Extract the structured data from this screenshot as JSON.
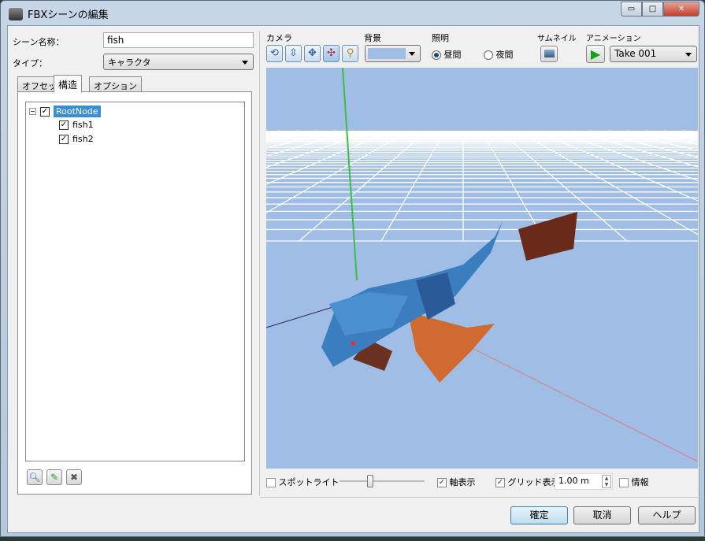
{
  "window": {
    "title": "FBXシーンの編集",
    "minimize": "▭",
    "maximize": "□",
    "close": "✕"
  },
  "left": {
    "scene_name_label": "シーン名称：",
    "scene_name_value": "fish",
    "type_label": "タイプ：",
    "type_value": "キャラクタ",
    "tabs": [
      {
        "label": "オフセット"
      },
      {
        "label": "構造"
      },
      {
        "label": "オプション"
      }
    ],
    "tree": {
      "root": "RootNode",
      "children": [
        {
          "label": "fish1",
          "checked": true
        },
        {
          "label": "fish2",
          "checked": true
        }
      ]
    }
  },
  "toolbar": {
    "camera_label": "カメラ",
    "background_label": "背景",
    "background_color": "#a0bde6",
    "lighting_label": "照明",
    "day_label": "昼間",
    "night_label": "夜間",
    "lighting_selected": "day",
    "thumbnail_label": "サムネイル",
    "animation_label": "アニメーション",
    "animation_value": "Take 001"
  },
  "bottom": {
    "spotlight_label": "スポットライト",
    "spotlight_checked": false,
    "slider_value_fraction": 0.35,
    "axis_label": "軸表示",
    "axis_checked": true,
    "grid_label": "グリッド表示",
    "grid_checked": true,
    "grid_size": "1.00 m",
    "info_label": "情報",
    "info_checked": false
  },
  "buttons": {
    "ok": "確定",
    "cancel": "取消",
    "help": "ヘルプ"
  }
}
